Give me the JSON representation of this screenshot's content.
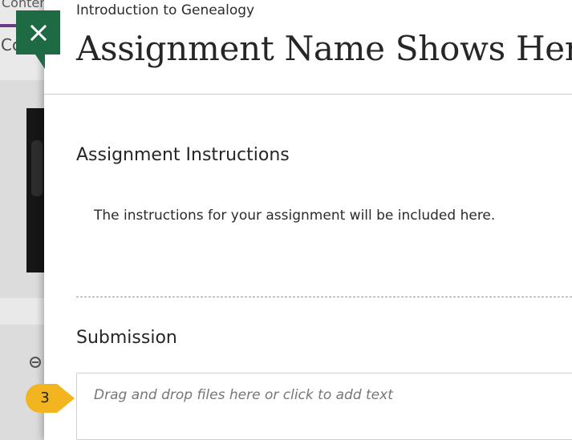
{
  "background": {
    "top_text": "Conter",
    "tab_text": "Co"
  },
  "close_button": {
    "icon": "close-icon",
    "color": "#1d6a45"
  },
  "panel": {
    "course_name": "Introduction to Genealogy",
    "assignment_title": "Assignment Name Shows Here",
    "instructions_heading": "Assignment Instructions",
    "instructions_text": "The instructions for your assignment will be included here.",
    "submission_heading": "Submission",
    "dropzone_placeholder": "Drag and drop files here or click to add text"
  },
  "step_marker": {
    "number": "3",
    "color": "#f2b520"
  }
}
